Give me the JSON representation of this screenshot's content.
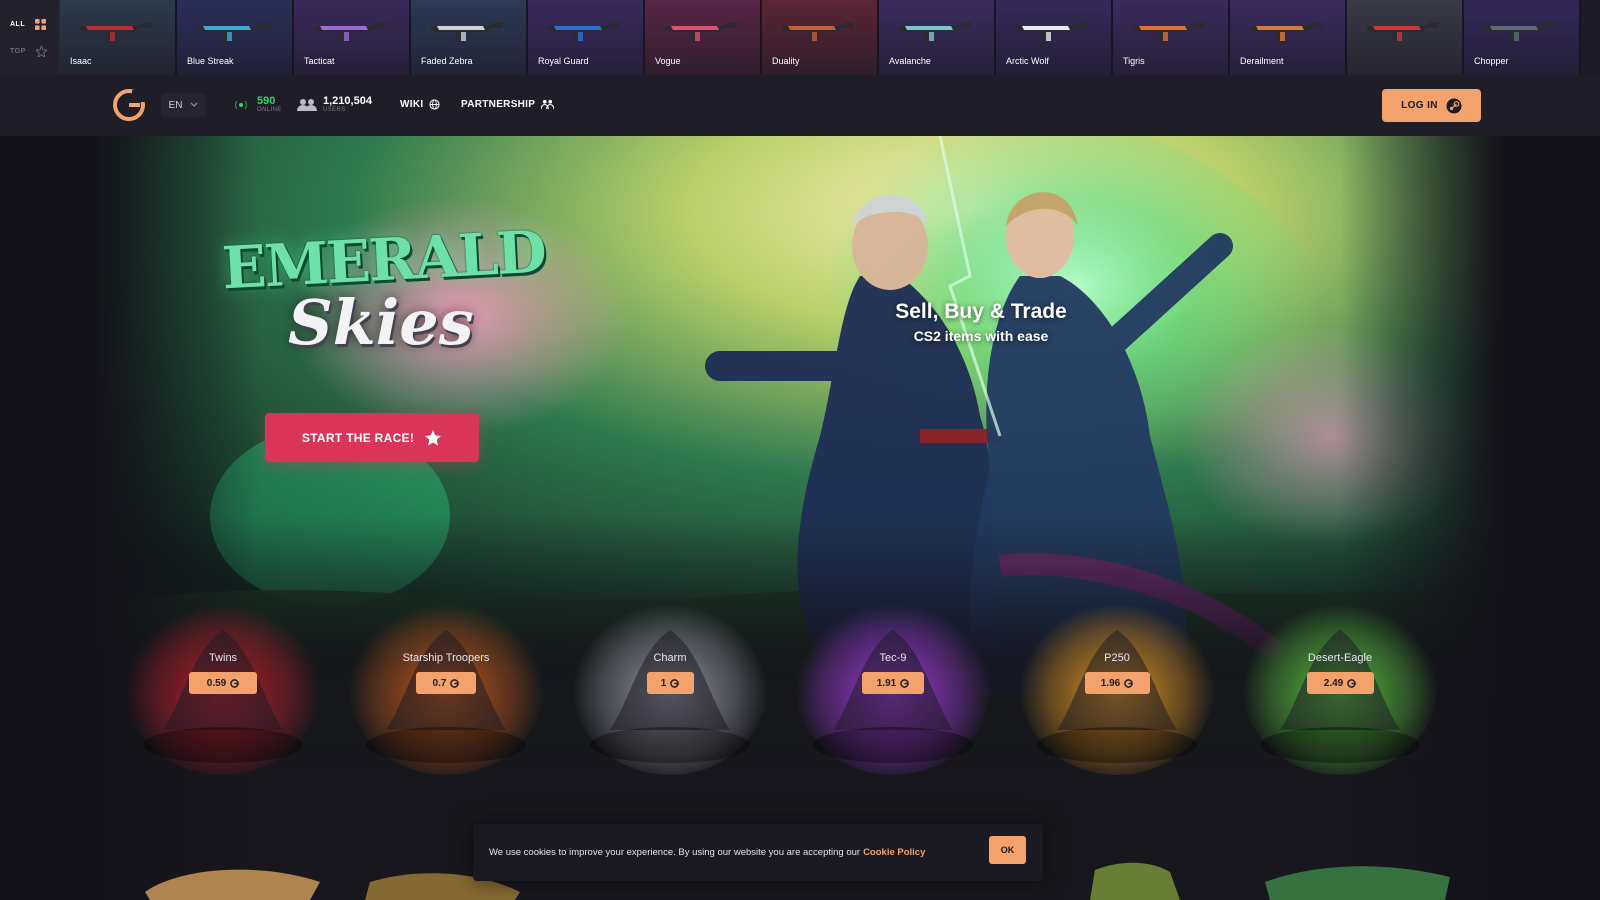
{
  "strip": {
    "tabs": [
      {
        "label": "ALL",
        "active": true
      },
      {
        "label": "TOP",
        "active": false
      }
    ],
    "drops": [
      {
        "name": "Isaac",
        "color": "#2d3a4a",
        "accent": "#b7313a"
      },
      {
        "name": "Blue Streak",
        "color": "#2a2f5a",
        "accent": "#3fa9d8"
      },
      {
        "name": "Tacticat",
        "color": "#3b2a5c",
        "accent": "#9a6ad6"
      },
      {
        "name": "Faded Zebra",
        "color": "#2c3a55",
        "accent": "#d0d0d8"
      },
      {
        "name": "Royal Guard",
        "color": "#3a2a60",
        "accent": "#2f6fd0"
      },
      {
        "name": "Vogue",
        "color": "#5a2545",
        "accent": "#e0506a"
      },
      {
        "name": "Duality",
        "color": "#5c2535",
        "accent": "#c0603c"
      },
      {
        "name": "Avalanche",
        "color": "#3b2c60",
        "accent": "#7fc4d6"
      },
      {
        "name": "Arctic Wolf",
        "color": "#35295c",
        "accent": "#e8e8ee"
      },
      {
        "name": "Tigris",
        "color": "#3b2a5e",
        "accent": "#e0702c"
      },
      {
        "name": "Derailment",
        "color": "#3a2b60",
        "accent": "#d87a3c"
      },
      {
        "name": "",
        "color": "#3a3a48",
        "accent": "#c83838"
      },
      {
        "name": "Chopper",
        "color": "#33285a",
        "accent": "#5a6a7a"
      }
    ]
  },
  "header": {
    "language": "EN",
    "online_count": "590",
    "online_label": "ONLINE",
    "users_count": "1,210,504",
    "users_label": "USERS",
    "wiki_label": "WIKI",
    "partnership_label": "PARTNERSHIP",
    "login_label": "LOG IN",
    "accent_color": "#f2a26a"
  },
  "hero": {
    "title_line1": "EMERALD",
    "title_line2": "Skies",
    "cta_label": "START THE RACE!",
    "slogan_line1": "Sell, Buy & Trade",
    "slogan_line2": "CS2 items with ease",
    "cta_color": "#d83559"
  },
  "cases": [
    {
      "name": "Twins",
      "price": "0.59",
      "glow": "#c0202c"
    },
    {
      "name": "Starship Troopers",
      "price": "0.7",
      "glow": "#c85a1c"
    },
    {
      "name": "Charm",
      "price": "1",
      "glow": "#9a9aa6"
    },
    {
      "name": "Tec-9",
      "price": "1.91",
      "glow": "#a43ce0"
    },
    {
      "name": "P250",
      "price": "1.96",
      "glow": "#e89a20"
    },
    {
      "name": "Desert-Eagle",
      "price": "2.49",
      "glow": "#5cc840"
    }
  ],
  "cookie": {
    "message": "We use cookies to improve your experience. By using our website you are accepting our",
    "link_label": "Cookie Policy",
    "ok_label": "OK"
  },
  "icons": {
    "grid": "grid-icon",
    "top": "star-badge-icon",
    "coin": "coin-icon",
    "steam": "steam-icon"
  }
}
